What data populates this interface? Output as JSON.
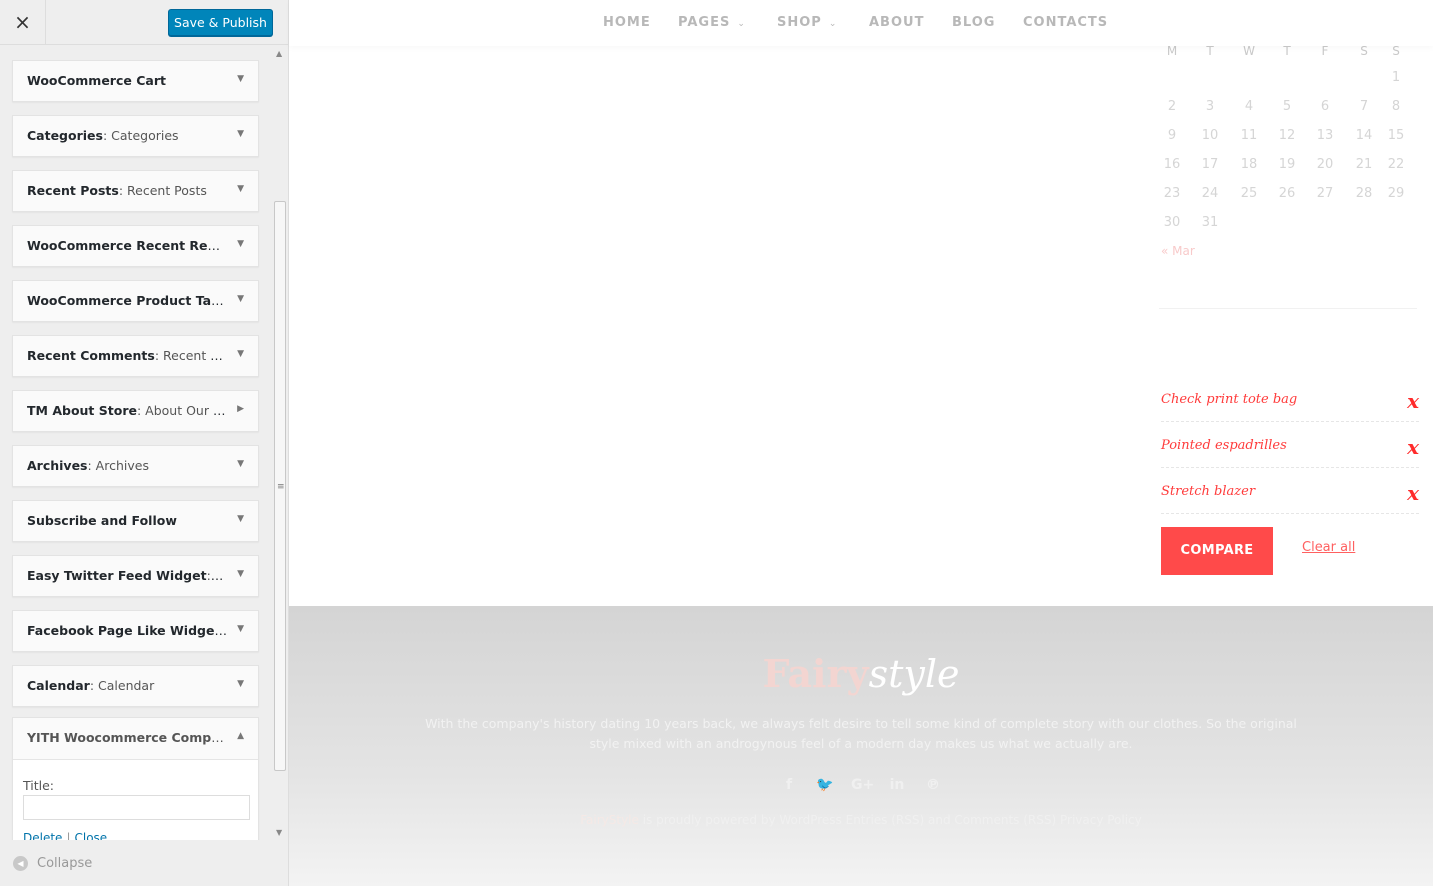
{
  "sidebar": {
    "close_icon": "×",
    "save_label": "Save & Publish",
    "collapse_label": "Collapse",
    "widgets": [
      {
        "name": "WooCommerce Cart",
        "sub": ""
      },
      {
        "name": "Categories",
        "sub": ": Categories"
      },
      {
        "name": "Recent Posts",
        "sub": ": Recent Posts"
      },
      {
        "name": "WooCommerce Recent Revie...",
        "sub": ""
      },
      {
        "name": "WooCommerce Product Tags:...",
        "sub": ""
      },
      {
        "name": "Recent Comments",
        "sub": ": Recent Co..."
      },
      {
        "name": "TM About Store",
        "sub": ": About Our St..."
      },
      {
        "name": "Archives",
        "sub": ": Archives"
      },
      {
        "name": "Subscribe and Follow",
        "sub": ""
      },
      {
        "name": "Easy Twitter Feed Widget",
        "sub": ": Twi..."
      },
      {
        "name": "Facebook Page Like Widget",
        "sub": ": F..."
      },
      {
        "name": "Calendar",
        "sub": ": Calendar"
      }
    ],
    "open_widget": {
      "name": "YITH Woocommerce Compar...",
      "title_label": "Title:",
      "title_value": "",
      "delete_label": "Delete",
      "close_label": "Close"
    }
  },
  "nav": {
    "items": [
      "HOME",
      "PAGES",
      "SHOP",
      "ABOUT",
      "BLOG",
      "CONTACTS"
    ]
  },
  "calendar": {
    "weekdays": [
      "M",
      "T",
      "W",
      "T",
      "F",
      "S",
      "S"
    ],
    "weeks": [
      [
        "",
        "",
        "",
        "",
        "",
        "",
        "1"
      ],
      [
        "2",
        "3",
        "4",
        "5",
        "6",
        "7",
        "8"
      ],
      [
        "9",
        "10",
        "11",
        "12",
        "13",
        "14",
        "15"
      ],
      [
        "16",
        "17",
        "18",
        "19",
        "20",
        "21",
        "22"
      ],
      [
        "23",
        "24",
        "25",
        "26",
        "27",
        "28",
        "29"
      ],
      [
        "30",
        "31",
        "",
        "",
        "",
        "",
        ""
      ]
    ],
    "prev_link": "« Mar"
  },
  "compare": {
    "items": [
      "Check print tote bag",
      "Pointed espadrilles",
      "Stretch blazer"
    ],
    "remove_glyph": "x",
    "compare_button": "COMPARE",
    "clear_all": "Clear all"
  },
  "footer": {
    "logo_part1": "Fairy",
    "logo_part2": "style",
    "description": "With the company's history dating 10 years back, we always felt desire to tell some kind of complete story with our clothes. So the original style mixed with an androgynous feel of a modern day makes us what we actually are.",
    "socials": [
      {
        "icon": "facebook-icon",
        "glyph": "f"
      },
      {
        "icon": "twitter-icon",
        "glyph": "🐦"
      },
      {
        "icon": "google-plus-icon",
        "glyph": "G+"
      },
      {
        "icon": "linkedin-icon",
        "glyph": "in"
      },
      {
        "icon": "pinterest-icon",
        "glyph": "℗"
      }
    ],
    "credits_brand": "FairyStyle",
    "credits_text": " is proudly powered by WordPress Entries (RSS) and Comments (RSS) Privacy Policy"
  },
  "colors": {
    "accent": "#ff4a4a",
    "publish_blue": "#0085ba"
  }
}
